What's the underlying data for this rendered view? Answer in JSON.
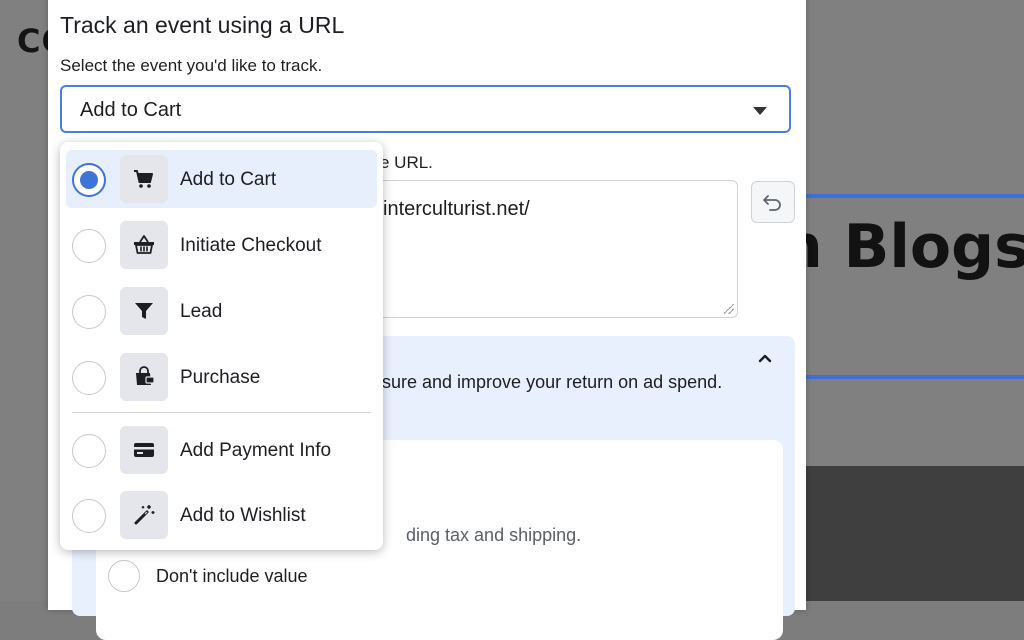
{
  "background": {
    "logo_text": "CO",
    "headline": "n Blogs",
    "accent_color": "#3d6fd6"
  },
  "modal": {
    "title": "Track an event using a URL",
    "subtitle": "Select the event you'd like to track.",
    "select": {
      "value": "Add to Cart"
    },
    "url_label": "e URL.",
    "url_value": "interculturist.net/",
    "info": {
      "text": "sure and improve your return on ad spend.",
      "value_desc": "ding tax and shipping.",
      "no_value_label": "Don't include value"
    }
  },
  "dropdown": {
    "selected_index": 0,
    "items": [
      {
        "label": "Add to Cart",
        "icon": "cart-icon"
      },
      {
        "label": "Initiate Checkout",
        "icon": "basket-icon"
      },
      {
        "label": "Lead",
        "icon": "funnel-icon"
      },
      {
        "label": "Purchase",
        "icon": "shopping-bag-icon"
      },
      {
        "label": "Add Payment Info",
        "icon": "credit-card-icon"
      },
      {
        "label": "Add to Wishlist",
        "icon": "magic-wand-icon"
      }
    ]
  },
  "colors": {
    "selected_bg": "#e7effd",
    "radio_blue": "#3e73d8",
    "focus_border": "#4a7de1"
  }
}
